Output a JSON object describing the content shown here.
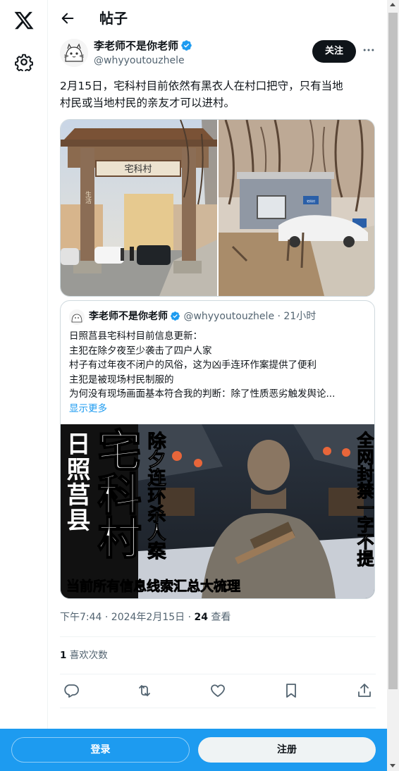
{
  "header": {
    "title": "帖子"
  },
  "author": {
    "name": "李老师不是你老师",
    "handle": "@whyyoutouzhele",
    "follow_label": "关注"
  },
  "post": {
    "text_line1": "2月15日，宅科村目前依然有黑衣人在村口把守，只有当地",
    "text_line2": "村民或当地村民的亲友才可以进村。",
    "gate_sign": "宅科村",
    "side_plaque": "生活",
    "house_sign": "宅科村"
  },
  "quote": {
    "name": "李老师不是你老师",
    "handle": "@whyyoutouzhele",
    "time": "· 21小时",
    "lines": [
      "日照莒县宅科村目前信息更新：",
      "主犯在除夕夜至少袭击了四户人家",
      "村子有过年夜不闭户的风俗，这为凶手连环作案提供了便利",
      "主犯是被现场村民制服的",
      "为何没有现场画面基本符合我的判断：除了性质恶劣触发舆论..."
    ],
    "show_more": "显示更多",
    "cover": {
      "left_col": "日照莒县",
      "big": "宅科村",
      "mid": "除夕连环杀人案",
      "right": "全网封禁一字不提",
      "bottom": "当前所有信息线索汇总大梳理"
    }
  },
  "meta": {
    "time": "下午7:44 · 2024年2月15日 · ",
    "views_count": "24",
    "views_label": " 查看"
  },
  "likes": {
    "count": "1",
    "label": " 喜欢次数"
  },
  "bottom": {
    "login": "登录",
    "signup": "注册"
  },
  "colors": {
    "accent": "#1d9bf0",
    "text": "#0f1419",
    "muted": "#536471"
  },
  "icons": [
    "x-logo-icon",
    "gear-icon",
    "back-arrow-icon",
    "verified-icon",
    "more-icon",
    "reply-icon",
    "retweet-icon",
    "like-icon",
    "bookmark-icon",
    "share-icon"
  ]
}
